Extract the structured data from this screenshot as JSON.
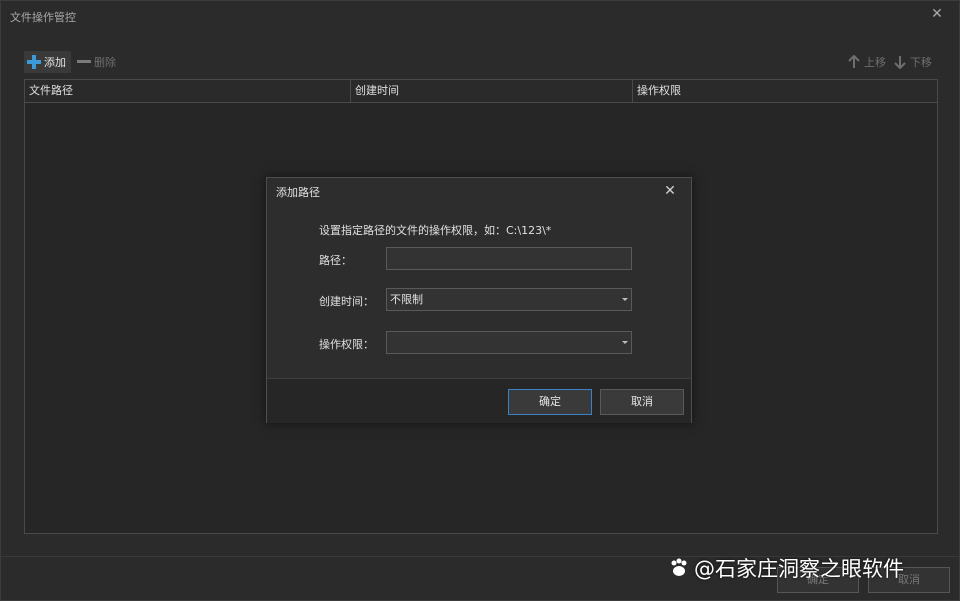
{
  "window": {
    "title": "文件操作管控",
    "close_glyph": "✕"
  },
  "toolbar": {
    "add_label": "添加",
    "delete_label": "删除",
    "up_label": "上移",
    "down_label": "下移"
  },
  "table": {
    "columns": [
      "文件路径",
      "创建时间",
      "操作权限"
    ],
    "rows": []
  },
  "footer": {
    "ok_label": "确定",
    "cancel_label": "取消"
  },
  "dialog": {
    "title": "添加路径",
    "close_glyph": "✕",
    "hint": "设置指定路径的文件的操作权限，如：C:\\123\\*",
    "path_label": "路径：",
    "path_value": "",
    "created_label": "创建时间：",
    "created_value": "不限制",
    "permission_label": "操作权限：",
    "permission_value": "",
    "ok_label": "确定",
    "cancel_label": "取消"
  },
  "watermark": {
    "text": "@石家庄洞察之眼软件"
  },
  "colors": {
    "background": "#2b2b2b",
    "accent": "#3d9ad9",
    "ok_border": "#3a82c4"
  }
}
